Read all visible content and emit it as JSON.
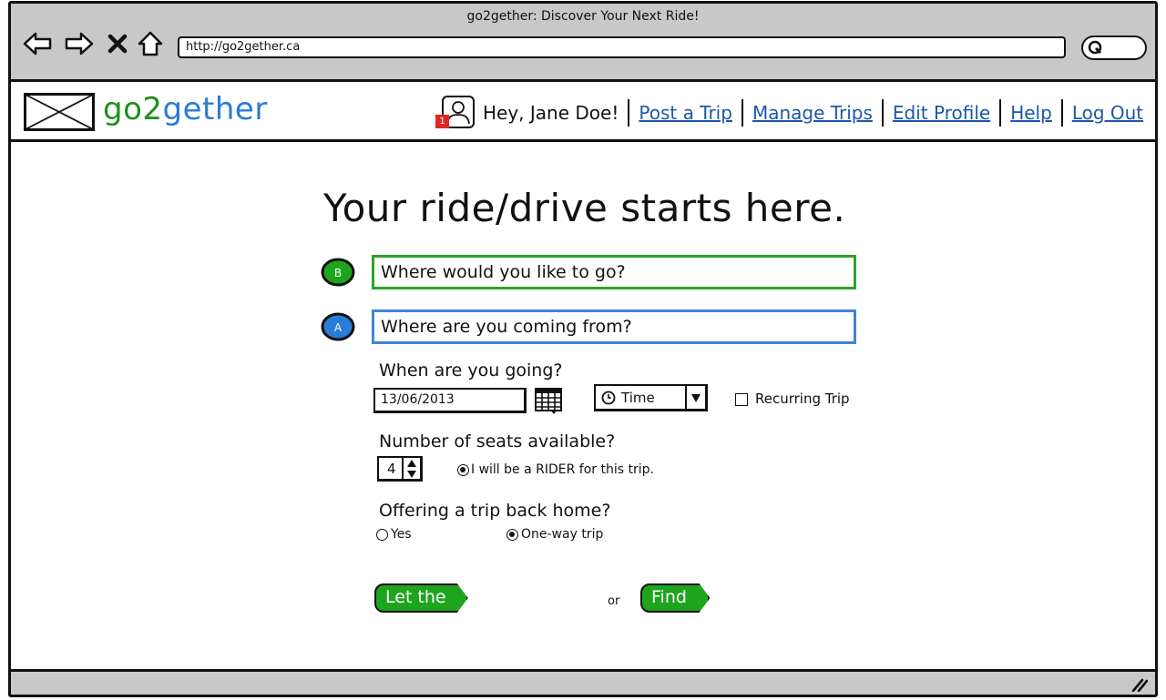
{
  "window": {
    "title": "go2gether: Discover Your Next Ride!",
    "url": "http://go2gether.ca"
  },
  "header": {
    "logo": {
      "go": "go",
      "two": "2",
      "gether": "gether"
    },
    "notification_count": "1",
    "greeting": "Hey, Jane Doe!",
    "nav": [
      "Post a Trip",
      "Manage Trips",
      "Edit Profile",
      "Help",
      "Log Out"
    ]
  },
  "form": {
    "headline": "Your ride/drive starts here.",
    "destination": {
      "marker": "B",
      "placeholder": "Where would you like to go?"
    },
    "origin": {
      "marker": "A",
      "placeholder": "Where are you coming from?"
    },
    "when_label": "When are you going?",
    "date_value": "13/06/2013",
    "time_label": "Time",
    "recurring_label": "Recurring Trip",
    "seats_label": "Number of seats available?",
    "seats_value": "4",
    "rider_label": "I will be a RIDER for this trip.",
    "return_label": "Offering a trip back home?",
    "return_options": [
      "Yes",
      "One-way trip"
    ],
    "return_selected": "One-way trip",
    "share_button": "Let the sharing begin!",
    "or_text": "or",
    "find_button": "Find me a ride!"
  },
  "colors": {
    "brand_green": "#1ea51e",
    "brand_blue": "#2b7bd8",
    "link": "#1d57a8",
    "chrome": "#c8c8c8"
  }
}
